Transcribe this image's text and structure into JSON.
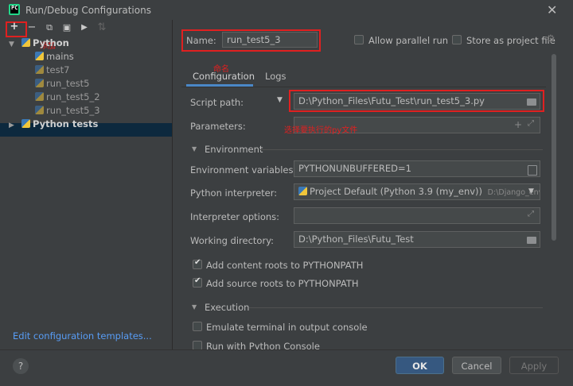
{
  "window": {
    "title": "Run/Debug Configurations",
    "close_glyph": "✕"
  },
  "toolbar": {
    "add": "+",
    "remove": "−",
    "copy": "⧉",
    "save": "▣",
    "move": "▶",
    "sort": "⇅"
  },
  "tree": {
    "python_group": "Python",
    "items": [
      "mains",
      "test7",
      "run_test5",
      "run_test5_2",
      "run_test5_3"
    ],
    "python_tests_group": "Python tests"
  },
  "annotations": {
    "add_note": "添加",
    "rename_note": "命名",
    "script_note": "选择要执行的py文件"
  },
  "left_footer": {
    "edit_templates": "Edit configuration templates..."
  },
  "name_row": {
    "label": "Name:",
    "value": "run_test5_3",
    "allow_parallel": "Allow parallel run",
    "store_as_project": "Store as project file"
  },
  "tabs": [
    "Configuration",
    "Logs"
  ],
  "config": {
    "script_path_label": "Script path:",
    "script_path_value": "D:\\Python_Files\\Futu_Test\\run_test5_3.py",
    "parameters_label": "Parameters:",
    "parameters_value": "",
    "environment_section": "Environment",
    "env_vars_label": "Environment variables:",
    "env_vars_value": "PYTHONUNBUFFERED=1",
    "interpreter_label": "Python interpreter:",
    "interpreter_value": "Project Default (Python 3.9 (my_env))",
    "interpreter_path": "D:\\Django_envwrap",
    "interp_options_label": "Interpreter options:",
    "interp_options_value": "",
    "working_dir_label": "Working directory:",
    "working_dir_value": "D:\\Python_Files\\Futu_Test",
    "add_content_roots": "Add content roots to PYTHONPATH",
    "add_source_roots": "Add source roots to PYTHONPATH",
    "execution_section": "Execution",
    "emulate_terminal": "Emulate terminal in output console",
    "run_with_console": "Run with Python Console"
  },
  "buttons": {
    "ok": "OK",
    "cancel": "Cancel",
    "apply": "Apply",
    "help": "?"
  }
}
